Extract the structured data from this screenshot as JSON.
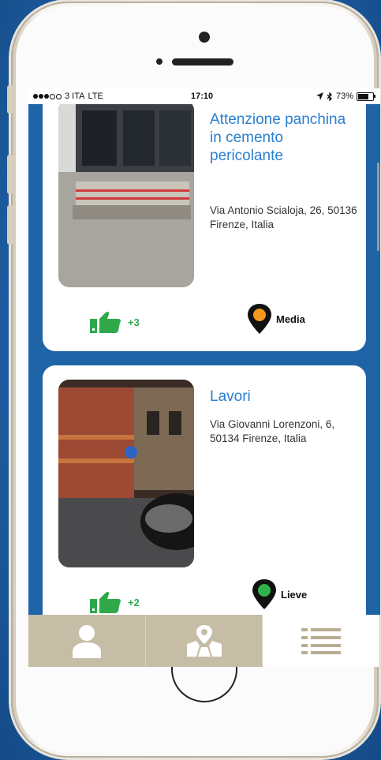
{
  "statusbar": {
    "carrier": "3 ITA",
    "network": "LTE",
    "time": "17:10",
    "battery": "73%",
    "battery_level": 0.73
  },
  "feed": {
    "items": [
      {
        "title": "Attenzione panchina in cemento pericolante",
        "address": "Via Antonio Scialoja, 26, 50136 Firenze, Italia",
        "likes": "+3",
        "severity": "Media",
        "severity_color": "#f39a1e"
      },
      {
        "title": "Lavori",
        "address": "Via Giovanni Lorenzoni, 6, 50134 Firenze, Italia",
        "likes": "+2",
        "severity": "Lieve",
        "severity_color": "#2fb14c"
      }
    ]
  },
  "tabbar": {
    "tabs": [
      {
        "icon": "profile-icon",
        "active": false
      },
      {
        "icon": "map-icon",
        "active": false
      },
      {
        "icon": "list-icon",
        "active": true
      }
    ]
  },
  "colors": {
    "accent": "#2a7fd1",
    "like_green": "#2fa84a",
    "tab_inactive": "#c6bda7",
    "tab_icon": "#ffffff",
    "list_icon": "#b8ad90"
  }
}
